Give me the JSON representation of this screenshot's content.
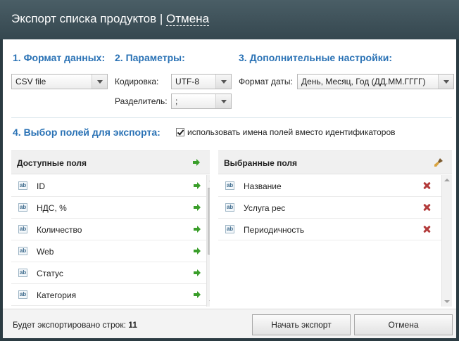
{
  "window": {
    "title": "Экспорт списка продуктов | ",
    "cancel_link": "Отмена"
  },
  "section1": {
    "title": "1. Формат данных:",
    "format_value": "CSV file"
  },
  "section2": {
    "title": "2. Параметры:",
    "encoding_label": "Кодировка:",
    "encoding_value": "UTF-8",
    "separator_label": "Разделитель:",
    "separator_value": ";"
  },
  "section3": {
    "title": "3. Дополнительные настройки:",
    "date_format_label": "Формат даты:",
    "date_format_value": "День, Месяц, Год (ДД.ММ.ГГГГ)"
  },
  "section4": {
    "title": "4. Выбор полей для экспорта:",
    "use_names_label": "использовать имена полей вместо идентификаторов",
    "use_names_checked": true
  },
  "available": {
    "header": "Доступные поля",
    "items": [
      {
        "type": "ab",
        "name": "ID"
      },
      {
        "type": "ab",
        "name": "НДС, %"
      },
      {
        "type": "ab",
        "name": "Количество"
      },
      {
        "type": "ab",
        "name": "Web"
      },
      {
        "type": "ab",
        "name": "Статус"
      },
      {
        "type": "ab",
        "name": "Категория"
      }
    ]
  },
  "selected": {
    "header": "Выбранные поля",
    "items": [
      {
        "type": "ab",
        "name": "Название"
      },
      {
        "type": "ab",
        "name": "Услуга                   рес"
      },
      {
        "type": "ab",
        "name": "Периодичность"
      }
    ]
  },
  "footer": {
    "rows_label": "Будет экспортировано строк:",
    "rows_count": "11",
    "start_button": "Начать экспорт",
    "cancel_button": "Отмена"
  },
  "colors": {
    "accent": "#2a72b5",
    "titlebar": "#3c4f57",
    "add_arrow": "#3a9e2a",
    "remove_x": "#b33b3b"
  }
}
